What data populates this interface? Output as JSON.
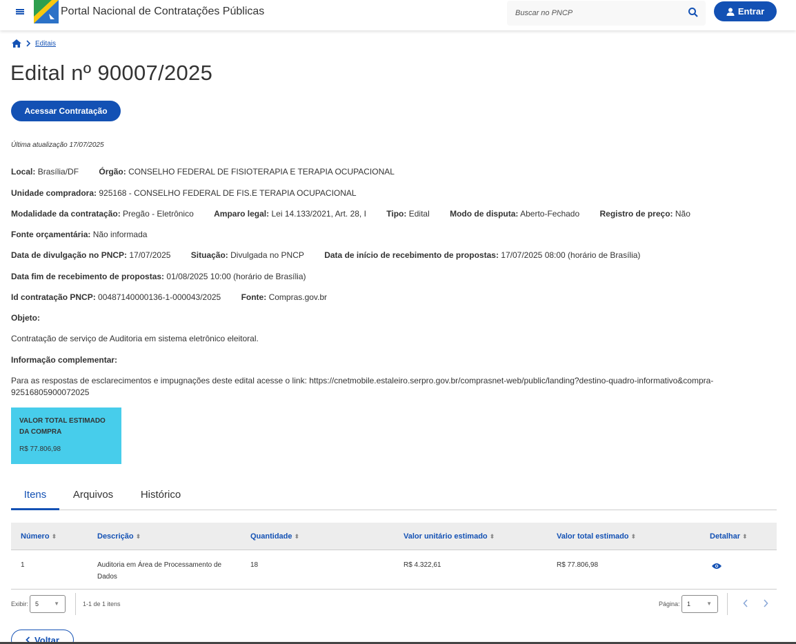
{
  "header": {
    "portal_title": "Portal Nacional de Contratações Públicas",
    "search_placeholder": "Buscar no PNCP",
    "login_label": "Entrar"
  },
  "breadcrumb": {
    "link": "Editais"
  },
  "page": {
    "title": "Edital nº 90007/2025",
    "access_button": "Acessar Contratação",
    "last_update": "Última atualização 17/07/2025"
  },
  "details": {
    "local_label": "Local:",
    "local": "Brasília/DF",
    "orgao_label": "Órgão:",
    "orgao": "CONSELHO FEDERAL DE FISIOTERAPIA E TERAPIA OCUPACIONAL",
    "unidade_label": "Unidade compradora:",
    "unidade": "925168 - CONSELHO FEDERAL DE FIS.E TERAPIA OCUPACIONAL",
    "modalidade_label": "Modalidade da contratação:",
    "modalidade": "Pregão - Eletrônico",
    "amparo_label": "Amparo legal:",
    "amparo": "Lei 14.133/2021, Art. 28, I",
    "tipo_label": "Tipo:",
    "tipo": "Edital",
    "modo_label": "Modo de disputa:",
    "modo": "Aberto-Fechado",
    "registro_label": "Registro de preço:",
    "registro": "Não",
    "fonte_orc_label": "Fonte orçamentária:",
    "fonte_orc": "Não informada",
    "data_div_label": "Data de divulgação no PNCP:",
    "data_div": "17/07/2025",
    "situacao_label": "Situação:",
    "situacao": "Divulgada no PNCP",
    "data_inicio_label": "Data de início de recebimento de propostas:",
    "data_inicio": "17/07/2025 08:00 (horário de Brasília)",
    "data_fim_label": "Data fim de recebimento de propostas:",
    "data_fim": "01/08/2025 10:00 (horário de Brasília)",
    "id_label": "Id contratação PNCP:",
    "id": "00487140000136-1-000043/2025",
    "fonte_label": "Fonte:",
    "fonte": "Compras.gov.br",
    "objeto_label": "Objeto:",
    "objeto": "Contratação de serviço de Auditoria em sistema eletrônico eleitoral.",
    "info_label": "Informação complementar:",
    "info": "Para as respostas de esclarecimentos e impugnações deste edital acesse o link: https://cnetmobile.estaleiro.serpro.gov.br/comprasnet-web/public/landing?destino-quadro-informativo&compra-92516805900072025"
  },
  "value_card": {
    "label": "VALOR TOTAL ESTIMADO DA COMPRA",
    "value": "R$ 77.806,98"
  },
  "tabs": [
    "Itens",
    "Arquivos",
    "Histórico"
  ],
  "table": {
    "headers": [
      "Número",
      "Descrição",
      "Quantidade",
      "Valor unitário estimado",
      "Valor total estimado",
      "Detalhar"
    ],
    "rows": [
      {
        "numero": "1",
        "descricao": "Auditoria em Área de Processamento de Dados",
        "quantidade": "18",
        "valor_unitario": "R$ 4.322,61",
        "valor_total": "R$ 77.806,98"
      }
    ]
  },
  "pagination": {
    "exibir_label": "Exibir:",
    "exibir_value": "5",
    "range_text": "1-1 de 1 itens",
    "pagina_label": "Página:",
    "pagina_value": "1"
  },
  "back_label": "Voltar",
  "colors": {
    "primary": "#1351b4",
    "card": "#47cdeb"
  }
}
